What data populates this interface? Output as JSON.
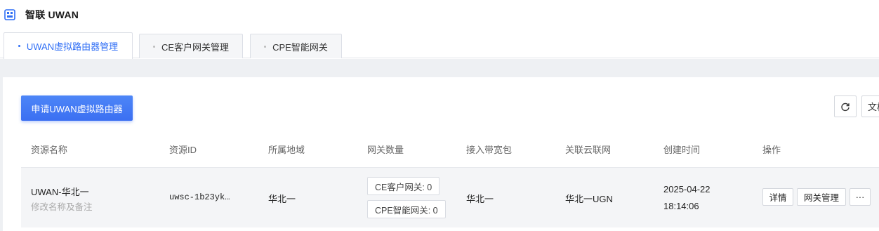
{
  "app": {
    "title": "智联 UWAN",
    "logo_icon": "network-grid-icon",
    "accent": "#2f6ef5"
  },
  "tabs": [
    {
      "label": "UWAN虚拟路由器管理",
      "active": true
    },
    {
      "label": "CE客户网关管理",
      "active": false
    },
    {
      "label": "CPE智能网关",
      "active": false
    }
  ],
  "toolbar": {
    "create_label": "申请UWAN虚拟路由器",
    "refresh_icon": "refresh-icon",
    "doc_label": "文档"
  },
  "table": {
    "columns": [
      "资源名称",
      "资源ID",
      "所属地域",
      "网关数量",
      "接入带宽包",
      "关联云联网",
      "创建时间",
      "操作"
    ],
    "rows": [
      {
        "name": "UWAN-华北一",
        "name_hint": "修改名称及备注",
        "id": "uwsc-1b23yk…",
        "region": "华北一",
        "ce_count": "CE客户网关: 0",
        "cpe_count": "CPE智能网关: 0",
        "bandwidth": "华北一",
        "cloud_net": "华北一UGN",
        "created_date": "2025-04-22",
        "created_time": "18:14:06",
        "actions": {
          "detail": "详情",
          "gateway": "网关管理",
          "more": "···"
        }
      }
    ]
  }
}
